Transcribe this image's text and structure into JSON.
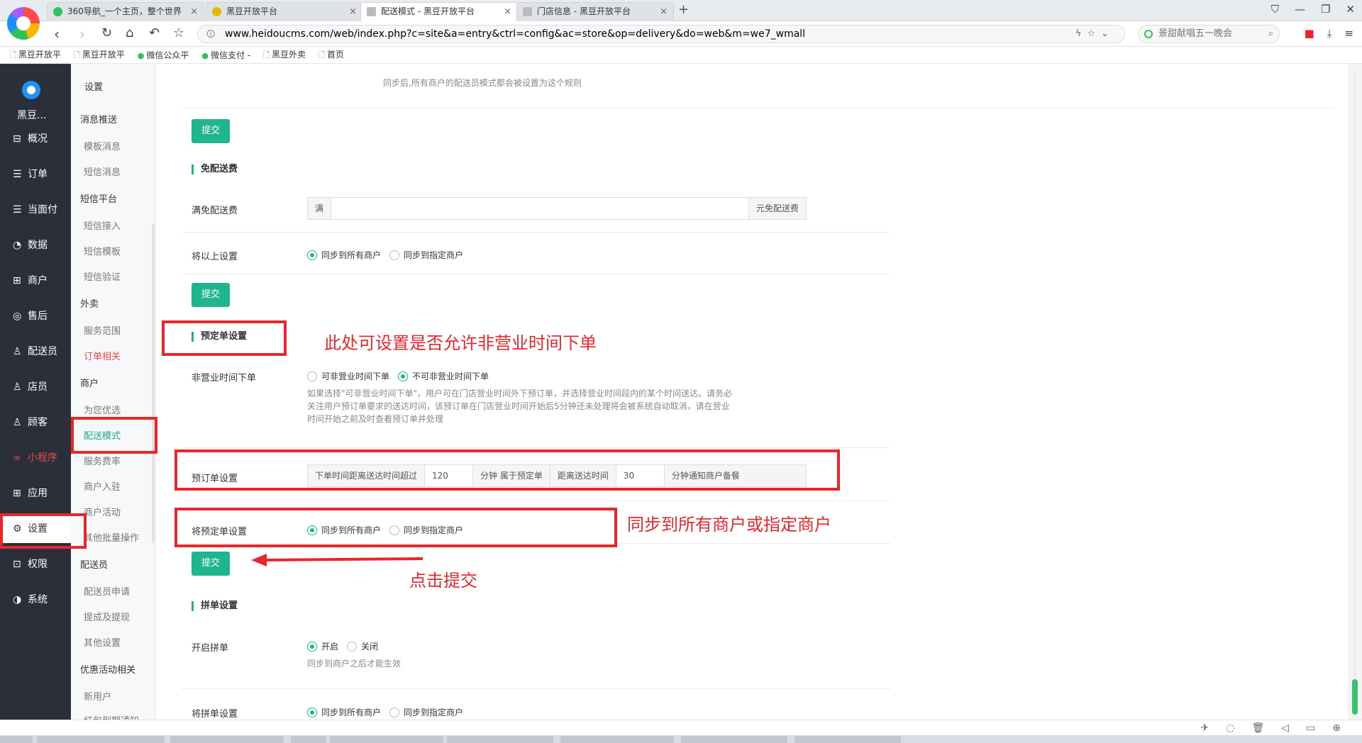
{
  "browser": {
    "tabs": [
      {
        "title": "360导航_一个主页，整个世界",
        "favicon_color": "#2fc25b"
      },
      {
        "title": "黑豆开放平台",
        "favicon_color": "#e6b800"
      },
      {
        "title": "配送模式 - 黑豆开放平台",
        "favicon_color": "#bbbbbb"
      },
      {
        "title": "门店信息 - 黑豆开放平台",
        "favicon_color": "#bbbbbb"
      }
    ],
    "url": "www.heidoucms.com/web/index.php?c=site&a=entry&ctrl=config&ac=store&op=delivery&do=web&m=we7_wmall",
    "search_text": "景甜献唱五一晚会",
    "bookmarks": [
      "黑豆开放平",
      "黑豆开放平",
      "微信公众平",
      "微信支付 -",
      "黑豆外卖",
      "首页"
    ]
  },
  "sidebar": {
    "brand": "黑豆...",
    "items": [
      {
        "icon": "overview-icon",
        "glyph": "⊟",
        "label": "概况"
      },
      {
        "icon": "order-icon",
        "glyph": "☰",
        "label": "订单"
      },
      {
        "icon": "pay-icon",
        "glyph": "☰",
        "label": "当面付"
      },
      {
        "icon": "data-icon",
        "glyph": "◔",
        "label": "数据"
      },
      {
        "icon": "store-icon",
        "glyph": "⊞",
        "label": "商户"
      },
      {
        "icon": "aftersale-icon",
        "glyph": "◎",
        "label": "售后"
      },
      {
        "icon": "courier-icon",
        "glyph": "♙",
        "label": "配送员"
      },
      {
        "icon": "clerk-icon",
        "glyph": "♙",
        "label": "店员"
      },
      {
        "icon": "customer-icon",
        "glyph": "♙",
        "label": "顾客"
      },
      {
        "icon": "miniapp-icon",
        "glyph": "∞",
        "label": "小程序"
      },
      {
        "icon": "app-icon",
        "glyph": "⊞",
        "label": "应用"
      },
      {
        "icon": "settings-icon",
        "glyph": "⚙",
        "label": "设置"
      },
      {
        "icon": "permission-icon",
        "glyph": "⊡",
        "label": "权限"
      },
      {
        "icon": "system-icon",
        "glyph": "◑",
        "label": "系统"
      }
    ]
  },
  "subnav": {
    "title": "设置",
    "groups": [
      {
        "label": "消息推送",
        "items": [
          "模板消息",
          "短信消息"
        ]
      },
      {
        "label": "短信平台",
        "items": [
          "短信接入",
          "短信模板",
          "短信验证"
        ]
      },
      {
        "label": "外卖",
        "items": [
          "服务范围",
          "订单相关"
        ]
      },
      {
        "label": "商户",
        "items": [
          "为您优选",
          "配送模式",
          "服务费率",
          "商户入驻",
          "商户活动",
          "其他批量操作"
        ]
      },
      {
        "label": "配送员",
        "items": [
          "配送员申请",
          "提成及提现",
          "其他设置"
        ]
      },
      {
        "label": "优惠活动相关",
        "items": [
          "新用户",
          "红包到期通知"
        ]
      }
    ]
  },
  "content": {
    "top_help": "同步后,所有商户的配送员模式都会被设置为这个规则",
    "submit_label": "提交",
    "free_delivery": {
      "title": "免配送费",
      "label": "满免配送费",
      "prefix": "满",
      "value": "",
      "suffix": "元免配送费"
    },
    "sync1": {
      "label": "将以上设置",
      "options": [
        "同步到所有商户",
        "同步到指定商户"
      ],
      "selected": 0
    },
    "preorder": {
      "title": "预定单设置",
      "offhours_label": "非营业时间下单",
      "offhours_options": [
        "可非营业时间下单",
        "不可非营业时间下单"
      ],
      "offhours_selected": 1,
      "help_lines": [
        "如果选择\"可非营业时间下单\"，用户可在门店营业时间外下预订单，并选择营业时间段内的某个时间送达。请务必",
        "关注用户预订单要求的送达时间，该预订单在门店营业时间开始后5分钟还未处理将会被系统自动取消，请在营业",
        "时间开始之前及时查看预订单并处理"
      ],
      "preorder_label": "预订单设置",
      "addon1": "下单时间距离送达时间超过",
      "value1": "120",
      "addon2": "分钟 属于预定单",
      "addon3": "距离送达时间",
      "value2": "30",
      "addon4": "分钟通知商户备餐",
      "sync_label": "将预定单设置",
      "sync_options": [
        "同步到所有商户",
        "同步到指定商户"
      ],
      "sync_selected": 0
    },
    "pindan": {
      "title": "拼单设置",
      "open_label": "开启拼单",
      "open_options": [
        "开启",
        "关闭"
      ],
      "open_selected": 0,
      "help": "同步到商户之后才能生效",
      "sync_label": "将拼单设置",
      "sync_options": [
        "同步到所有商户",
        "同步到指定商户"
      ],
      "sync_selected": 0
    }
  },
  "annotations": {
    "note1": "此处可设置是否允许非营业时间下单",
    "note2": "同步到所有商户或指定商户",
    "note3": "点击提交",
    "color": "#e8262c"
  }
}
